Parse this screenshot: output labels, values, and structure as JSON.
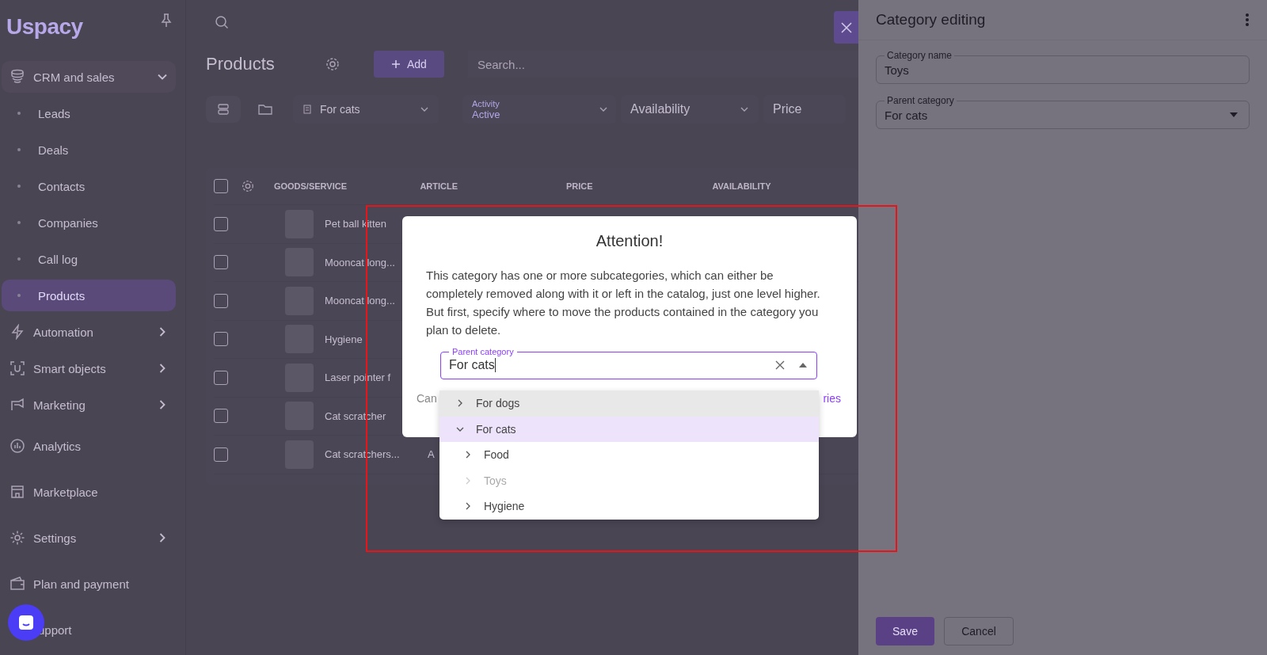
{
  "sidebar": {
    "logo": "Uspacy",
    "items": [
      {
        "label": "CRM and sales",
        "kind": "group",
        "expanded": true,
        "selected": false
      },
      {
        "label": "Leads",
        "kind": "sub",
        "selected": false
      },
      {
        "label": "Deals",
        "kind": "sub",
        "selected": false
      },
      {
        "label": "Contacts",
        "kind": "sub",
        "selected": false
      },
      {
        "label": "Companies",
        "kind": "sub",
        "selected": false
      },
      {
        "label": "Call log",
        "kind": "sub",
        "selected": false
      },
      {
        "label": "Products",
        "kind": "sub",
        "selected": true
      },
      {
        "label": "Automation",
        "kind": "group",
        "expanded": false,
        "selected": false
      },
      {
        "label": "Smart objects",
        "kind": "group",
        "expanded": false,
        "selected": false
      },
      {
        "label": "Marketing",
        "kind": "group",
        "expanded": false,
        "selected": false
      },
      {
        "label": "Analytics",
        "kind": "link",
        "selected": false
      },
      {
        "label": "Marketplace",
        "kind": "link",
        "selected": false
      },
      {
        "label": "Settings",
        "kind": "group",
        "expanded": false,
        "selected": false
      },
      {
        "label": "Plan and payment",
        "kind": "link",
        "selected": false
      },
      {
        "label": "upport",
        "kind": "link",
        "selected": false
      }
    ]
  },
  "page": {
    "title": "Products",
    "add_button": "Add",
    "search": {
      "placeholder": "Search..."
    },
    "filters": [
      {
        "kind": "category",
        "value": "For cats"
      },
      {
        "kind": "labeled",
        "label": "Activity",
        "value": "Active"
      },
      {
        "kind": "plain",
        "value": "Availability"
      },
      {
        "kind": "plain",
        "value": "Price"
      }
    ]
  },
  "table": {
    "header_checked": false,
    "columns": [
      "GOODS/SERVICE",
      "ARTICLE",
      "PRICE",
      "AVAILABILITY"
    ],
    "rows": [
      {
        "name": "Pet ball kitten",
        "checked": false
      },
      {
        "name": "Mooncat long...",
        "checked": false
      },
      {
        "name": "Mooncat long...",
        "checked": false
      },
      {
        "name": "Hygiene",
        "checked": false
      },
      {
        "name": "Laser pointer f",
        "checked": false
      },
      {
        "name": "Cat scratcher",
        "checked": false
      },
      {
        "name": "Cat scratchers...",
        "article": "A",
        "checked": false
      }
    ]
  },
  "panel": {
    "title": "Category editing",
    "fields": [
      {
        "kind": "text",
        "label": "Category name",
        "value": "Toys"
      },
      {
        "kind": "select",
        "label": "Parent category",
        "value": "For cats"
      }
    ],
    "save": "Save",
    "cancel": "Cancel"
  },
  "dialog": {
    "title": "Attention!",
    "message": "This category has one or more subcategories, which can either be completely removed along with it or left in the catalog, just one level higher. But first, specify where to move the products contained in the category you plan to delete.",
    "field": {
      "label": "Parent category",
      "value": "For cats"
    },
    "footer_left": "Can",
    "footer_right": "ries",
    "options": [
      {
        "label": "For dogs",
        "expanded": false,
        "selected": false,
        "hovered": true,
        "disabled": false
      },
      {
        "label": "For cats",
        "expanded": true,
        "selected": true,
        "hovered": false,
        "disabled": false,
        "children": [
          {
            "label": "Food",
            "expanded": false,
            "selected": false,
            "hovered": false,
            "disabled": false
          },
          {
            "label": "Toys",
            "expanded": false,
            "selected": false,
            "hovered": false,
            "disabled": true
          },
          {
            "label": "Hygiene",
            "expanded": false,
            "selected": false,
            "hovered": false,
            "disabled": false
          }
        ]
      }
    ]
  }
}
